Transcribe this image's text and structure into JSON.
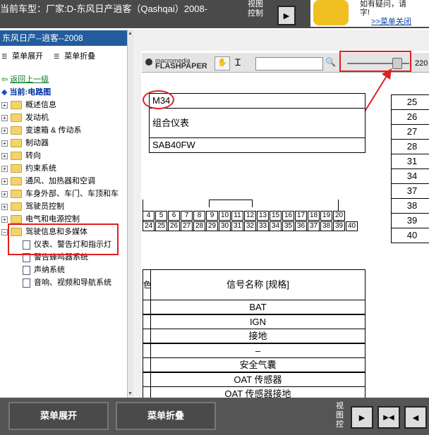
{
  "header": {
    "title": "当前车型：厂家:D-东风日产逍客（Qashqai）2008-",
    "view_control": "视图控制"
  },
  "banner": {
    "line1": "如有疑问，请",
    "line2": "字!",
    "link": ">>菜单关闭"
  },
  "sidebar": {
    "heading": "东风日产--逍客--2008",
    "expand": "菜单展开",
    "collapse": "菜单折叠",
    "back": "返回上一级",
    "current": "当前:电路图",
    "items": [
      {
        "label": "概述信息"
      },
      {
        "label": "发动机"
      },
      {
        "label": "变速箱 & 传动系"
      },
      {
        "label": "制动器"
      },
      {
        "label": "转向"
      },
      {
        "label": "约束系统"
      },
      {
        "label": "通风、加热器和空调"
      },
      {
        "label": "车身外部、车门、车顶和车"
      },
      {
        "label": "驾驶员控制"
      },
      {
        "label": "电气和电源控制"
      },
      {
        "label": "驾驶信息和多媒体"
      }
    ],
    "children": [
      {
        "label": "仪表、警告灯和指示灯"
      },
      {
        "label": "警告蜂鸣器系统"
      },
      {
        "label": "声纳系统"
      },
      {
        "label": "音响、视频和导航系统"
      }
    ]
  },
  "flashpaper": {
    "brand_small": "macromedia",
    "brand": "FLASHPAPER",
    "zoom": "220"
  },
  "diagram": {
    "connector_id": "M34",
    "component": "组合仪表",
    "part_no": "SAB40FW",
    "pins_top": [
      "4",
      "5",
      "6",
      "7",
      "8",
      "9",
      "10",
      "11",
      "12",
      "13",
      "15",
      "16",
      "17",
      "18",
      "19",
      "20"
    ],
    "pins_bottom": [
      "24",
      "25",
      "26",
      "27",
      "28",
      "29",
      "30",
      "31",
      "32",
      "33",
      "34",
      "35",
      "36",
      "37",
      "38",
      "39",
      "40"
    ],
    "right_numbers": [
      "25",
      "26",
      "27",
      "28",
      "31",
      "34",
      "37",
      "38",
      "39",
      "40"
    ],
    "signal_header": "信号名称 [规格]",
    "header_fragment": "色",
    "signals": [
      "BAT",
      "IGN",
      "接地",
      "–",
      "安全气囊",
      "OAT 传感器",
      "OAT 传感器接地"
    ]
  },
  "footer": {
    "expand_button": "菜单展开",
    "collapse_button": "菜单折叠",
    "view_control": "视图控"
  },
  "colors": {
    "highlight": "#e02020",
    "sidebar_header": "#225c9c",
    "link": "#0645ad"
  }
}
